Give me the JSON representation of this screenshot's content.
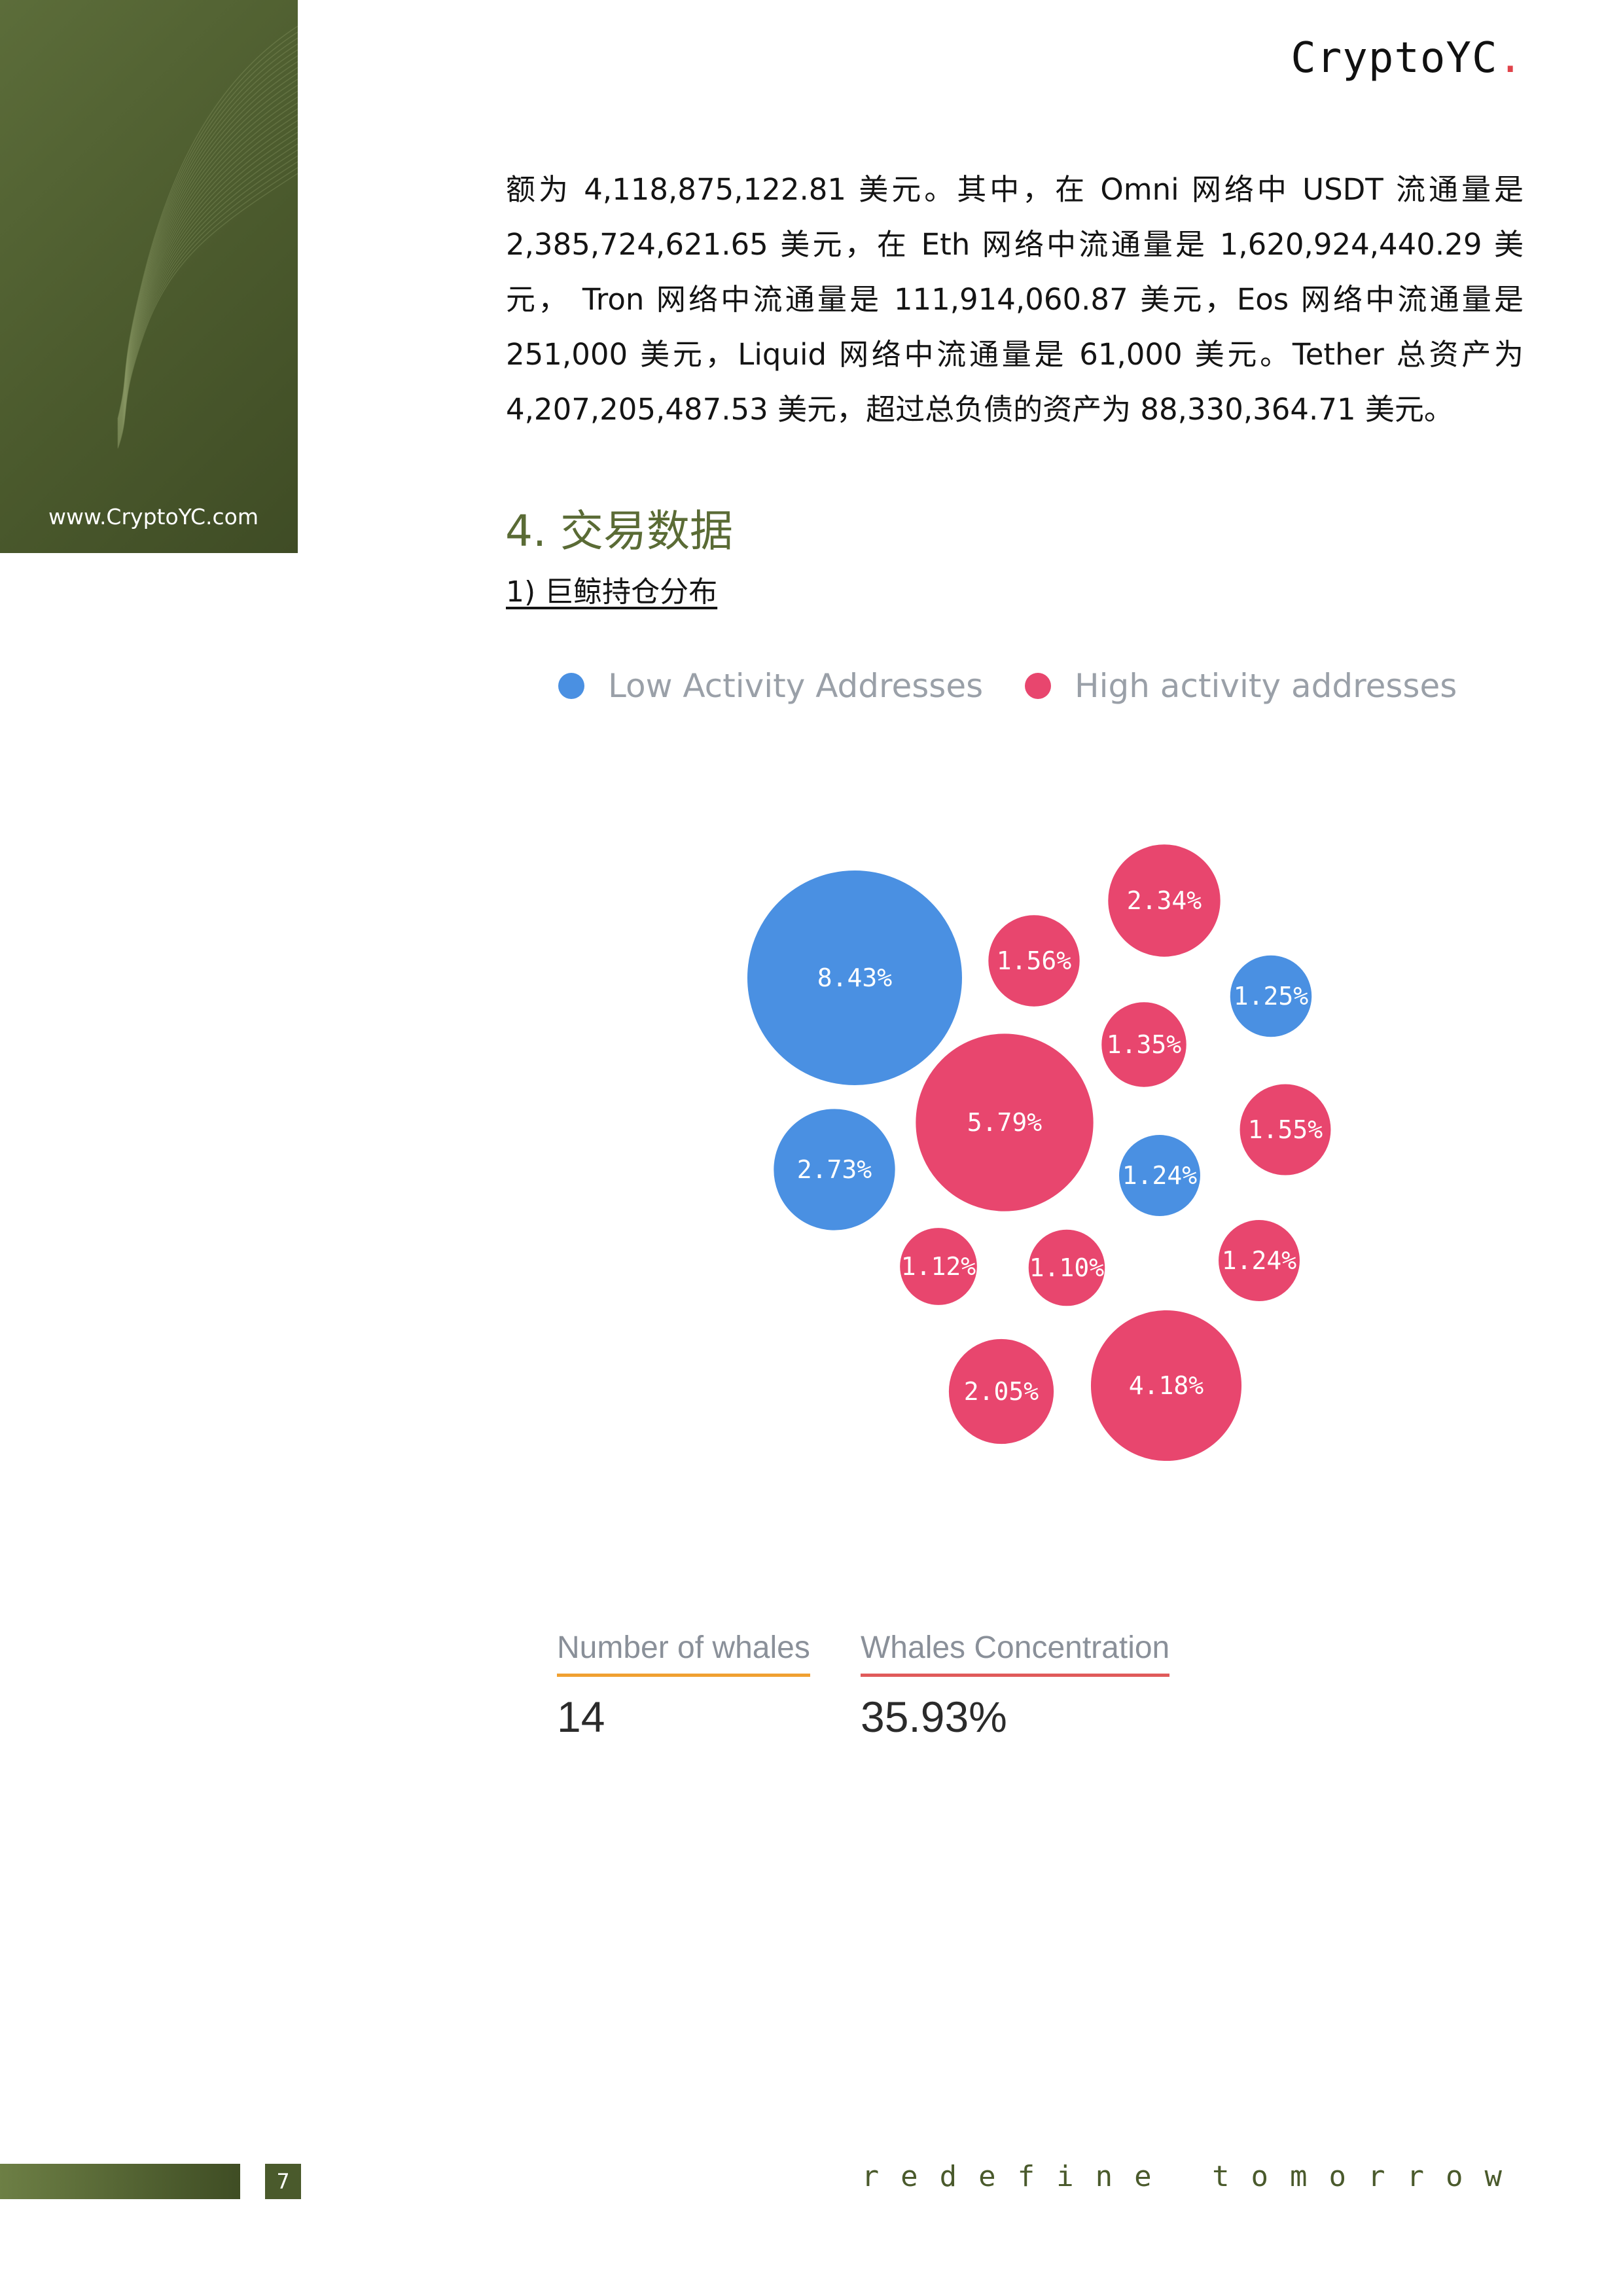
{
  "sidebar": {
    "url": "www.CryptoYC.com"
  },
  "header": {
    "brand": "CryptoYC",
    "brand_dot": "."
  },
  "body_text": "额为 4,118,875,122.81 美元。其中，在 Omni 网络中 USDT 流通量是 2,385,724,621.65 美元，在 Eth 网络中流通量是 1,620,924,440.29 美元， Tron 网络中流通量是 111,914,060.87 美元，Eos 网络中流通量是 251,000 美元，Liquid 网络中流通量是 61,000 美元。Tether 总资产为 4,207,205,487.53 美元，超过总负债的资产为 88,330,364.71 美元。",
  "section": {
    "heading": "4. 交易数据",
    "subheading": "1) 巨鲸持仓分布"
  },
  "chart_data": {
    "type": "bubble",
    "legend": [
      {
        "name": "Low Activity Addresses",
        "color": "#4a90e2"
      },
      {
        "name": "High activity addresses",
        "color": "#e8466e"
      }
    ],
    "bubbles": [
      {
        "label": "8.43%",
        "value": 8.43,
        "series": "Low Activity Addresses"
      },
      {
        "label": "1.56%",
        "value": 1.56,
        "series": "High activity addresses"
      },
      {
        "label": "2.34%",
        "value": 2.34,
        "series": "High activity addresses"
      },
      {
        "label": "1.25%",
        "value": 1.25,
        "series": "Low Activity Addresses"
      },
      {
        "label": "1.35%",
        "value": 1.35,
        "series": "High activity addresses"
      },
      {
        "label": "5.79%",
        "value": 5.79,
        "series": "High activity addresses"
      },
      {
        "label": "1.55%",
        "value": 1.55,
        "series": "High activity addresses"
      },
      {
        "label": "2.73%",
        "value": 2.73,
        "series": "Low Activity Addresses"
      },
      {
        "label": "1.24%",
        "value": 1.24,
        "series": "Low Activity Addresses"
      },
      {
        "label": "1.12%",
        "value": 1.12,
        "series": "High activity addresses"
      },
      {
        "label": "1.10%",
        "value": 1.1,
        "series": "High activity addresses"
      },
      {
        "label": "1.24%",
        "value": 1.24,
        "series": "High activity addresses"
      },
      {
        "label": "2.05%",
        "value": 2.05,
        "series": "High activity addresses"
      },
      {
        "label": "4.18%",
        "value": 4.18,
        "series": "High activity addresses"
      }
    ]
  },
  "stats": [
    {
      "label": "Number of whales",
      "value": "14",
      "underline_color": "#f0a030"
    },
    {
      "label": "Whales Concentration",
      "value": "35.93%",
      "underline_color": "#e05a5a"
    }
  ],
  "footer": {
    "page_number": "7",
    "tagline": "redefine tomorrow"
  }
}
